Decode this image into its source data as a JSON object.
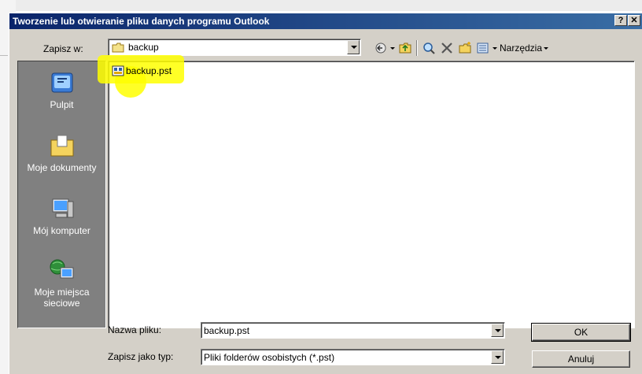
{
  "dialog": {
    "title": "Tworzenie lub otwieranie pliku danych programu Outlook",
    "help_label": "?",
    "close_label": "✕"
  },
  "location": {
    "label": "Zapisz w:",
    "value": "backup"
  },
  "toolbar": {
    "back_icon": "back-icon",
    "up_icon": "up-folder-icon",
    "search_icon": "search-web-icon",
    "delete_icon": "delete-icon",
    "new_folder_icon": "new-folder-icon",
    "views_icon": "views-icon",
    "tools_label": "Narzędzia"
  },
  "places": [
    {
      "label": "Pulpit",
      "icon": "desktop-icon"
    },
    {
      "label": "Moje dokumenty",
      "icon": "my-documents-icon"
    },
    {
      "label": "Mój komputer",
      "icon": "my-computer-icon"
    },
    {
      "label": "Moje miejsca sieciowe",
      "icon": "network-places-icon"
    }
  ],
  "files": [
    {
      "name": "backup.pst",
      "icon": "pst-file-icon"
    }
  ],
  "form": {
    "filename_label": "Nazwa pliku:",
    "filename_value": "backup.pst",
    "filetype_label": "Zapisz jako typ:",
    "filetype_value": "Pliki folderów osobistych (*.pst)"
  },
  "buttons": {
    "ok": "OK",
    "cancel": "Anuluj"
  },
  "colors": {
    "title_gradient_start": "#0a246a",
    "title_gradient_end": "#3a6ea5",
    "highlight": "#ffff00",
    "dialog_face": "#d4d0c8"
  }
}
